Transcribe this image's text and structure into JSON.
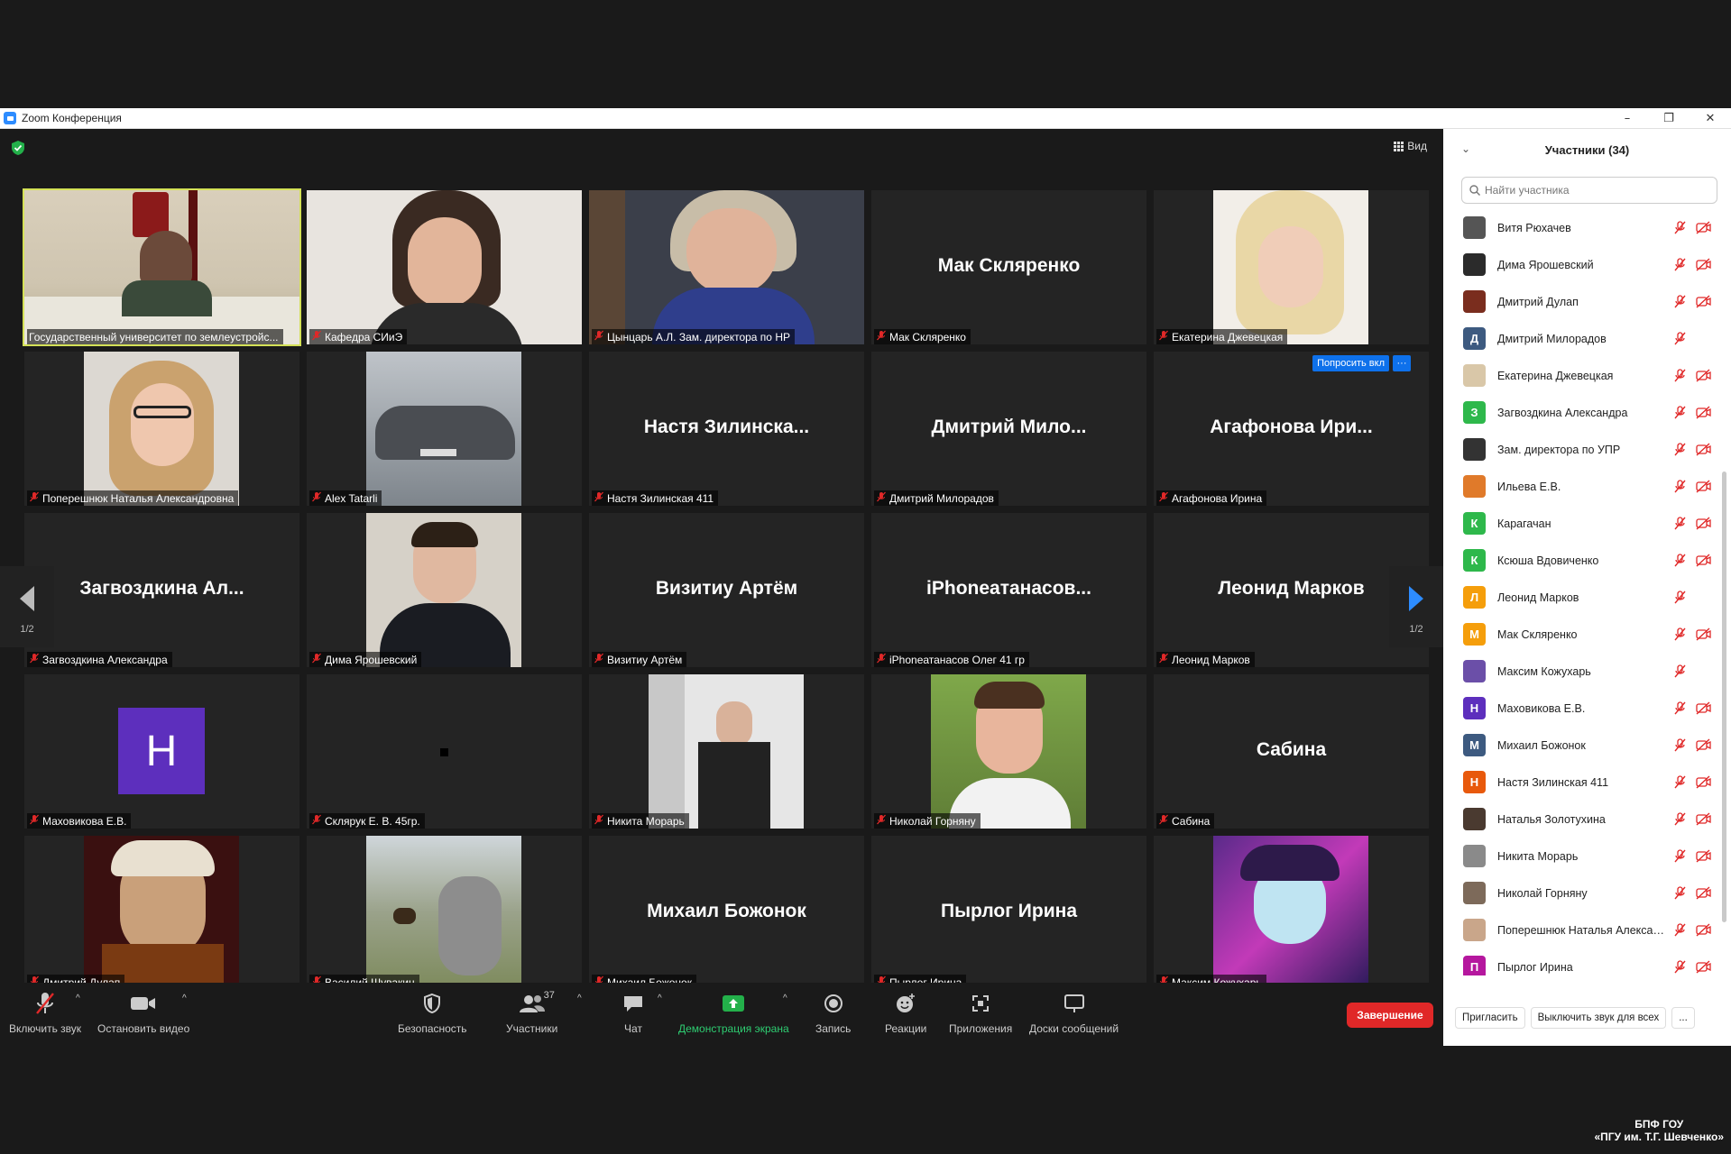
{
  "window": {
    "title": "Zoom Конференция",
    "minimize": "–",
    "restore": "❐",
    "close": "✕"
  },
  "meeting": {
    "view_label": "Вид",
    "ask_unmute": "Попросить вкл",
    "ask_more": "···",
    "page_left": "1/2",
    "page_right": "1/2",
    "tiles": [
      {
        "name": "Государственный университет по землеустройс...",
        "big": "",
        "type": "video-room",
        "active": true
      },
      {
        "name": "Кафедра СИиЭ",
        "big": "",
        "type": "video-woman1"
      },
      {
        "name": "Цынцарь А.Л. Зам. директора по НР",
        "big": "",
        "type": "video-woman2"
      },
      {
        "name": "Мак Скляренко",
        "big": "Мак Скляренко",
        "type": "text"
      },
      {
        "name": "Екатерина Джевецкая",
        "big": "",
        "type": "photo-blonde"
      },
      {
        "name": "Поперешнюк Наталья Александровна",
        "big": "",
        "type": "photo-glasses"
      },
      {
        "name": "Alex Tatarli",
        "big": "",
        "type": "photo-car"
      },
      {
        "name": "Настя Зилинская 411",
        "big": "Настя Зилинска...",
        "type": "text"
      },
      {
        "name": "Дмитрий Милорадов",
        "big": "Дмитрий Мило...",
        "type": "text"
      },
      {
        "name": "Агафонова Ирина",
        "big": "Агафонова Ири...",
        "type": "text-ask"
      },
      {
        "name": "Загвоздкина Александра",
        "big": "Загвоздкина Ал...",
        "type": "text"
      },
      {
        "name": "Дима Ярошевский",
        "big": "",
        "type": "photo-man"
      },
      {
        "name": "Визитиу Артём",
        "big": "Визитиу Артём",
        "type": "text"
      },
      {
        "name": "iPhoneатанасов Олег 41 гр",
        "big": "iPhoneатанасов...",
        "type": "text"
      },
      {
        "name": "Леонид Марков",
        "big": "Леонид Марков",
        "type": "text"
      },
      {
        "name": "Маховикова Е.В.",
        "big": "",
        "type": "avatar-h",
        "initial": "Н"
      },
      {
        "name": "Склярук Е. В. 45гр.",
        "big": "",
        "type": "black-dot"
      },
      {
        "name": "Никита Морарь",
        "big": "",
        "type": "photo-selfie"
      },
      {
        "name": "Николай Горняну",
        "big": "",
        "type": "photo-boy"
      },
      {
        "name": "Сабина",
        "big": "Сабина",
        "type": "text"
      },
      {
        "name": "Дмитрий Дулап",
        "big": "",
        "type": "photo-anime"
      },
      {
        "name": "Василий Шувакин",
        "big": "",
        "type": "photo-cat"
      },
      {
        "name": "Михаил Божонок",
        "big": "Михаил Божонок",
        "type": "text"
      },
      {
        "name": "Пырлог Ирина",
        "big": "Пырлог Ирина",
        "type": "text"
      },
      {
        "name": "Максим Кожухарь",
        "big": "",
        "type": "photo-art"
      }
    ]
  },
  "toolbar": {
    "unmute": "Включить звук",
    "stop_video": "Остановить видео",
    "security": "Безопасность",
    "participants": "Участники",
    "participants_count": "37",
    "chat": "Чат",
    "share": "Демонстрация экрана",
    "record": "Запись",
    "reactions": "Реакции",
    "apps": "Приложения",
    "whiteboards": "Доски сообщений",
    "end": "Завершение"
  },
  "panel": {
    "title": "Участники (34)",
    "search_placeholder": "Найти участника",
    "invite": "Пригласить",
    "mute_all": "Выключить звук для всех",
    "more": "...",
    "participants": [
      {
        "name": "Витя Рюхачев",
        "avatar": "photo",
        "color": "#555555",
        "initial": "",
        "cam": true
      },
      {
        "name": "Дима Ярошевский",
        "avatar": "photo",
        "color": "#2b2b2b",
        "initial": "",
        "cam": true
      },
      {
        "name": "Дмитрий Дулап",
        "avatar": "photo",
        "color": "#7a2d1e",
        "initial": "",
        "cam": true
      },
      {
        "name": "Дмитрий Милорадов",
        "avatar": "letter",
        "color": "#3d5a80",
        "initial": "Д",
        "cam": false
      },
      {
        "name": "Екатерина Джевецкая",
        "avatar": "photo",
        "color": "#d9c7a8",
        "initial": "",
        "cam": true
      },
      {
        "name": "Загвоздкина Александра",
        "avatar": "letter",
        "color": "#2eb84b",
        "initial": "З",
        "cam": true
      },
      {
        "name": "Зам. директора по УПР",
        "avatar": "photo",
        "color": "#333333",
        "initial": "",
        "cam": true
      },
      {
        "name": "Ильева Е.В.",
        "avatar": "photo",
        "color": "#e07a2a",
        "initial": "",
        "cam": true
      },
      {
        "name": "Карагачан",
        "avatar": "letter",
        "color": "#2eb84b",
        "initial": "К",
        "cam": true
      },
      {
        "name": "Ксюша Вдовиченко",
        "avatar": "letter",
        "color": "#2eb84b",
        "initial": "К",
        "cam": true
      },
      {
        "name": "Леонид Марков",
        "avatar": "letter",
        "color": "#f59e0b",
        "initial": "Л",
        "cam": false
      },
      {
        "name": "Мак Скляренко",
        "avatar": "letter",
        "color": "#f59e0b",
        "initial": "М",
        "cam": true
      },
      {
        "name": "Максим Кожухарь",
        "avatar": "photo",
        "color": "#6b4fa8",
        "initial": "",
        "cam": false
      },
      {
        "name": "Маховикова Е.В.",
        "avatar": "letter",
        "color": "#5d2fbd",
        "initial": "Н",
        "cam": true
      },
      {
        "name": "Михаил Божонок",
        "avatar": "letter",
        "color": "#3d5a80",
        "initial": "М",
        "cam": true
      },
      {
        "name": "Настя Зилинская 411",
        "avatar": "letter",
        "color": "#e8590c",
        "initial": "Н",
        "cam": true
      },
      {
        "name": "Наталья Золотухина",
        "avatar": "photo",
        "color": "#4a3a30",
        "initial": "",
        "cam": true
      },
      {
        "name": "Никита Морарь",
        "avatar": "photo",
        "color": "#8a8a8a",
        "initial": "",
        "cam": true
      },
      {
        "name": "Николай Горняну",
        "avatar": "photo",
        "color": "#7d6a5a",
        "initial": "",
        "cam": true
      },
      {
        "name": "Поперешнюк Наталья Александровна",
        "avatar": "photo",
        "color": "#c9a68a",
        "initial": "",
        "cam": true
      },
      {
        "name": "Пырлог Ирина",
        "avatar": "letter",
        "color": "#b5179e",
        "initial": "П",
        "cam": true
      }
    ]
  },
  "watermark": {
    "line1": "БПФ ГОУ",
    "line2": "«ПГУ им. Т.Г. Шевченко»"
  }
}
